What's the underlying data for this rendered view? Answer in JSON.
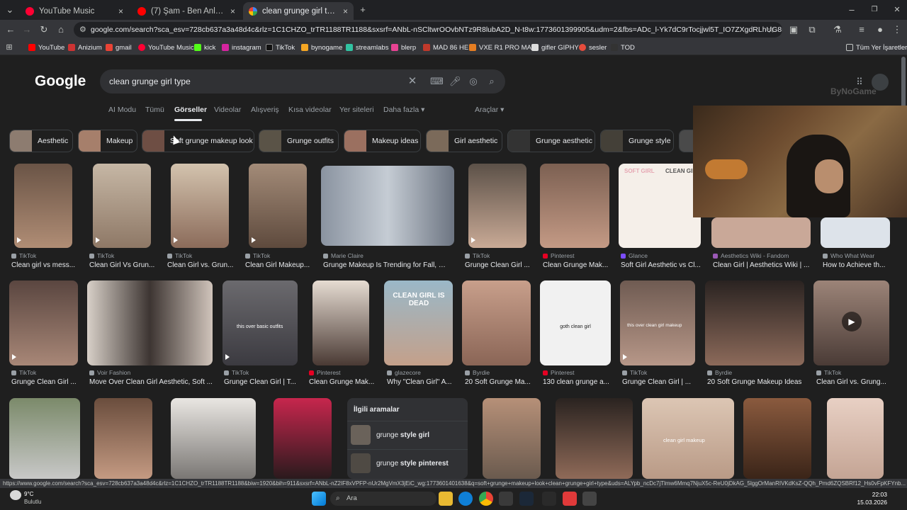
{
  "tabs": [
    {
      "label": "YouTube Music",
      "close": "×"
    },
    {
      "label": "(7) Şam - Ben Anlamam (Pr",
      "close": "×"
    },
    {
      "label": "clean grunge girl type - Google",
      "close": "×"
    }
  ],
  "new_tab": "+",
  "window_controls": [
    "–",
    "❐",
    "✕"
  ],
  "toolbar": {
    "url": "google.com/search?sca_esv=728cb637a3a48d4c&rlz=1C1CHZO_trTR1188TR1188&sxsrf=ANbL-nSCltwrOOvbNTz9R8lubA2D_N-t8w:1773601399905&udm=2&fbs=ADc_l-Yk7dC9rTocjjwl5T_IO7ZXgdRLhUG8pk-pM063RkPIlQJoVs..."
  },
  "bookmarks": [
    "YouTube",
    "Anizium",
    "gmail",
    "YouTube Music",
    "kick",
    "instagram",
    "TikTok",
    "bynogame",
    "streamlabs",
    "blerp",
    "MAD 86 HE",
    "VXE R1 PRO MAX",
    "gifler GIPHY",
    "sesler",
    "TOD"
  ],
  "bookmarks_all": "Tüm Yer İşaretleri",
  "google": {
    "logo": "Google",
    "query": "clean grunge girl type",
    "watermark": "ByNoGame"
  },
  "nav": [
    "AI Modu",
    "Tümü",
    "Görseller",
    "Videolar",
    "Alışveriş",
    "Kısa videolar",
    "Yer siteleri",
    "Daha fazla ▾",
    "Araçlar ▾"
  ],
  "chips": [
    "Aesthetic",
    "Makeup",
    "Soft grunge makeup look",
    "Grunge outfits",
    "Makeup ideas",
    "Girl aesthetic",
    "Grunge aesthetic",
    "Grunge style"
  ],
  "row1": [
    {
      "source": "TikTok",
      "title": "Clean girl vs mess..."
    },
    {
      "source": "TikTok",
      "title": "Clean Girl Vs Grun..."
    },
    {
      "source": "TikTok",
      "title": "Clean Girl vs. Grun..."
    },
    {
      "source": "TikTok",
      "title": "Clean Girl Makeup..."
    },
    {
      "source": "Marie Claire",
      "title": "Grunge Makeup Is Trending for Fall, wit..."
    },
    {
      "source": "TikTok",
      "title": "Grunge Clean Girl ..."
    },
    {
      "source": "Pinterest",
      "title": "Clean Grunge Mak..."
    },
    {
      "source": "Glance",
      "title": "Soft Girl Aesthetic vs Cl..."
    },
    {
      "source": "Aesthetics Wiki - Fandom",
      "title": "Clean Girl | Aesthetics Wiki | ..."
    },
    {
      "source": "Who What Wear",
      "title": "How to Achieve th..."
    }
  ],
  "row2": [
    {
      "source": "TikTok",
      "title": "Grunge Clean Girl ..."
    },
    {
      "source": "Voir Fashion",
      "title": "Move Over Clean Girl Aesthetic, Soft ..."
    },
    {
      "source": "TikTok",
      "title": "Grunge Clean Girl | T..."
    },
    {
      "source": "Pinterest",
      "title": "Clean Grunge Mak..."
    },
    {
      "source": "glazecore",
      "title": "Why \"Clean Girl\" A..."
    },
    {
      "source": "Byrdie",
      "title": "20 Soft Grunge Ma..."
    },
    {
      "source": "Pinterest",
      "title": "130 clean grunge a..."
    },
    {
      "source": "TikTok",
      "title": "Grunge Clean Girl | ..."
    },
    {
      "source": "Byrdie",
      "title": "20 Soft Grunge Makeup Ideas"
    },
    {
      "source": "TikTok",
      "title": "Clean Girl vs. Grung..."
    }
  ],
  "image_text": {
    "clean_girl_dead": "CLEAN GIRL IS DEAD",
    "soft_girl": "SOFT GIRL",
    "clean_gir": "CLEAN GIR",
    "basic_outfits": "this over basic outfits",
    "goth_clean": "goth clean girl",
    "this_over": "this over clean girl makeup",
    "clean_girl_makeup": "clean girl makeup"
  },
  "related": {
    "title": "İlgili aramalar",
    "items": [
      {
        "prefix": "grunge ",
        "bold": "style girl"
      },
      {
        "prefix": "grunge ",
        "bold": "style pinterest"
      }
    ]
  },
  "status_url": "https://www.google.com/search?sca_esv=728cb637a3a48d4c&rlz=1C1CHZO_trTR1188TR1188&biw=1920&bih=911&sxsrf=ANbL-nZ2IF8xVPFP-nUr2MgVmX3jEiC_wg:1773601401638&q=soft+grunge+makeup+look+clean+grunge+girl+type&uds=ALYpb_ncDc7jTlmw6Mmq7NjuX5c-ReU0jDkAG_5lggOrManRIVKdKsZ-QQh_Pmd6ZQSBRf12_Hs0vFpKFYnb...",
  "taskbar": {
    "temp": "9°C",
    "weather": "Bulutlu",
    "search": "Ara",
    "time": "22:03",
    "date": "15.03.2026"
  },
  "colors": {
    "accent": "#8ab4f8",
    "page_bg": "#1f1f1f",
    "search_bg": "#303134"
  }
}
